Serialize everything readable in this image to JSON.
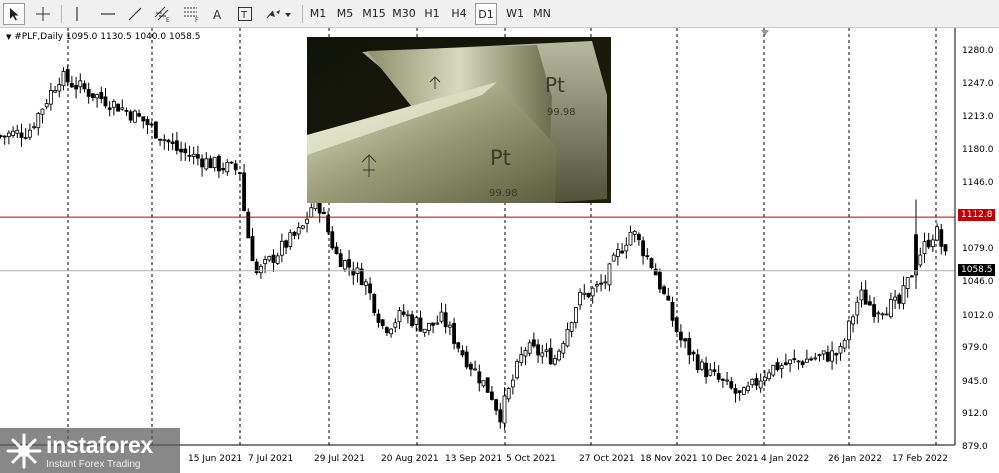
{
  "toolbar": {
    "timeframes": [
      "M1",
      "M5",
      "M15",
      "M30",
      "H1",
      "H4",
      "D1",
      "W1",
      "MN"
    ],
    "active_timeframe": "D1",
    "tools": [
      "cursor-arrow",
      "crosshair",
      "vertical-line",
      "horizontal-line",
      "trendline",
      "equidistant-channel",
      "fibonacci-retracement",
      "text-label",
      "text-box",
      "arrow-tools-menu"
    ]
  },
  "chart": {
    "symbol_line": "#PLF,Daily  1095.0 1130.5 1040.0 1058.5",
    "symbol": "#PLF",
    "timeframe": "Daily",
    "ohlc": {
      "open": 1095.0,
      "high": 1130.5,
      "low": 1040.0,
      "close": 1058.5
    },
    "price_levels": [
      "1280.0",
      "1247.0",
      "1213.0",
      "1180.0",
      "1146.0",
      "1112.8",
      "1079.0",
      "1058.5",
      "1046.0",
      "1012.0",
      "979.0",
      "945.0",
      "912.0",
      "879.0"
    ],
    "price_tag_red": "1112.8",
    "price_tag_current": "1058.5",
    "date_labels": [
      "15 Jun 2021",
      "7 Jul 2021",
      "29 Jul 2021",
      "20 Aug 2021",
      "13 Sep 2021",
      "5 Oct 2021",
      "27 Oct 2021",
      "18 Nov 2021",
      "10 Dec 2021",
      "4 Jan 2022",
      "26 Jan 2022",
      "17 Feb 2022"
    ],
    "colors": {
      "background": "#ffffff",
      "candle": "#000000",
      "grid": "#000000",
      "red_line": "#c00000",
      "current_line": "#b0b0b0"
    },
    "image_caption": [
      "Pt",
      "99.98"
    ]
  },
  "chart_data": {
    "type": "candlestick",
    "title": "#PLF,Daily",
    "ylim": [
      879,
      1280
    ],
    "grid": "vertical dashed",
    "horizontal_lines": [
      1112.8,
      1058.5
    ],
    "x_ticks": [
      "15 Jun 2021",
      "7 Jul 2021",
      "29 Jul 2021",
      "20 Aug 2021",
      "13 Sep 2021",
      "5 Oct 2021",
      "27 Oct 2021",
      "18 Nov 2021",
      "10 Dec 2021",
      "4 Jan 2022",
      "26 Jan 2022",
      "17 Feb 2022"
    ],
    "y_ticks": [
      1280.0,
      1247.0,
      1213.0,
      1180.0,
      1146.0,
      1079.0,
      1046.0,
      1012.0,
      979.0,
      945.0,
      912.0,
      879.0
    ],
    "close_path": [
      {
        "date": "2021-03-22",
        "close": 1195
      },
      {
        "date": "2021-04-01",
        "close": 1200
      },
      {
        "date": "2021-04-12",
        "close": 1255
      },
      {
        "date": "2021-04-22",
        "close": 1240
      },
      {
        "date": "2021-05-03",
        "close": 1225
      },
      {
        "date": "2021-05-12",
        "close": 1210
      },
      {
        "date": "2021-05-24",
        "close": 1180
      },
      {
        "date": "2021-06-07",
        "close": 1165
      },
      {
        "date": "2021-06-15",
        "close": 1160
      },
      {
        "date": "2021-06-17",
        "close": 1105
      },
      {
        "date": "2021-06-21",
        "close": 1055
      },
      {
        "date": "2021-07-01",
        "close": 1085
      },
      {
        "date": "2021-07-07",
        "close": 1100
      },
      {
        "date": "2021-07-12",
        "close": 1135
      },
      {
        "date": "2021-07-19",
        "close": 1075
      },
      {
        "date": "2021-07-29",
        "close": 1050
      },
      {
        "date": "2021-08-05",
        "close": 1000
      },
      {
        "date": "2021-08-12",
        "close": 1015
      },
      {
        "date": "2021-08-20",
        "close": 1000
      },
      {
        "date": "2021-08-26",
        "close": 1010
      },
      {
        "date": "2021-09-02",
        "close": 975
      },
      {
        "date": "2021-09-13",
        "close": 930
      },
      {
        "date": "2021-09-15",
        "close": 910
      },
      {
        "date": "2021-09-24",
        "close": 980
      },
      {
        "date": "2021-10-05",
        "close": 970
      },
      {
        "date": "2021-10-13",
        "close": 1030
      },
      {
        "date": "2021-10-22",
        "close": 1045
      },
      {
        "date": "2021-10-27",
        "close": 1075
      },
      {
        "date": "2021-11-01",
        "close": 1100
      },
      {
        "date": "2021-11-09",
        "close": 1060
      },
      {
        "date": "2021-11-18",
        "close": 990
      },
      {
        "date": "2021-11-26",
        "close": 960
      },
      {
        "date": "2021-12-10",
        "close": 930
      },
      {
        "date": "2021-12-20",
        "close": 960
      },
      {
        "date": "2022-01-04",
        "close": 970
      },
      {
        "date": "2022-01-14",
        "close": 975
      },
      {
        "date": "2022-01-21",
        "close": 1035
      },
      {
        "date": "2022-01-26",
        "close": 1020
      },
      {
        "date": "2022-02-04",
        "close": 1025
      },
      {
        "date": "2022-02-11",
        "close": 1075
      },
      {
        "date": "2022-02-17",
        "close": 1100
      },
      {
        "date": "2022-02-22",
        "close": 1058.5
      }
    ]
  },
  "watermark": {
    "name": "instaforex",
    "tagline": "Instant Forex Trading"
  }
}
